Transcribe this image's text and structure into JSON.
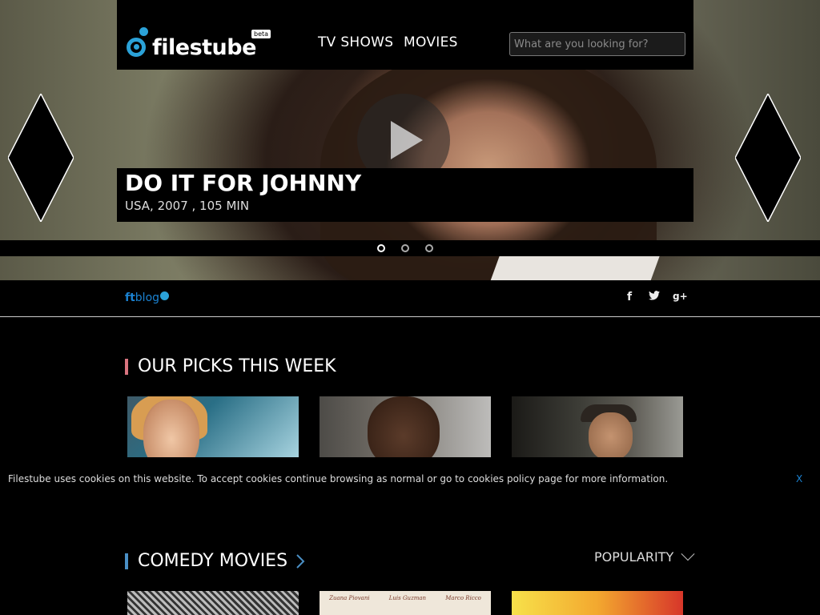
{
  "header": {
    "logo_text": "filestube",
    "beta_label": "beta",
    "nav": [
      {
        "label": "TV SHOWS"
      },
      {
        "label": "MOVIES"
      }
    ],
    "search_placeholder": "What are you looking for?"
  },
  "hero": {
    "title": "DO IT FOR JOHNNY",
    "meta": "USA, 2007 , 105 MIN",
    "slide_count": 3,
    "active_slide": 1
  },
  "blogbar": {
    "ft": "ft",
    "blog": "blog",
    "social": {
      "facebook": "f",
      "twitter": "🐦",
      "googleplus": "g+"
    }
  },
  "picks": {
    "title": "OUR PICKS THIS WEEK",
    "accent": "#d9747f"
  },
  "cookie": {
    "message": "Filestube uses cookies on this website. To accept cookies continue browsing as normal or go to cookies policy page for more information.",
    "close_label": "X"
  },
  "comedy": {
    "title": "COMEDY MOVIES",
    "accent": "#4a8fc5",
    "sort_label": "POPULARITY",
    "poster2_names": [
      "Zuana Piovani",
      "Luis Guzman",
      "Marco Ricco"
    ]
  },
  "colors": {
    "brand_blue": "#2ba2d8",
    "link_blue": "#1b82d1",
    "background": "#000000"
  },
  "icons": [
    "logo-icon",
    "play-icon",
    "prev-arrow-icon",
    "next-arrow-icon",
    "facebook-icon",
    "twitter-icon",
    "googleplus-icon",
    "chevron-right-icon",
    "chevron-down-icon"
  ]
}
